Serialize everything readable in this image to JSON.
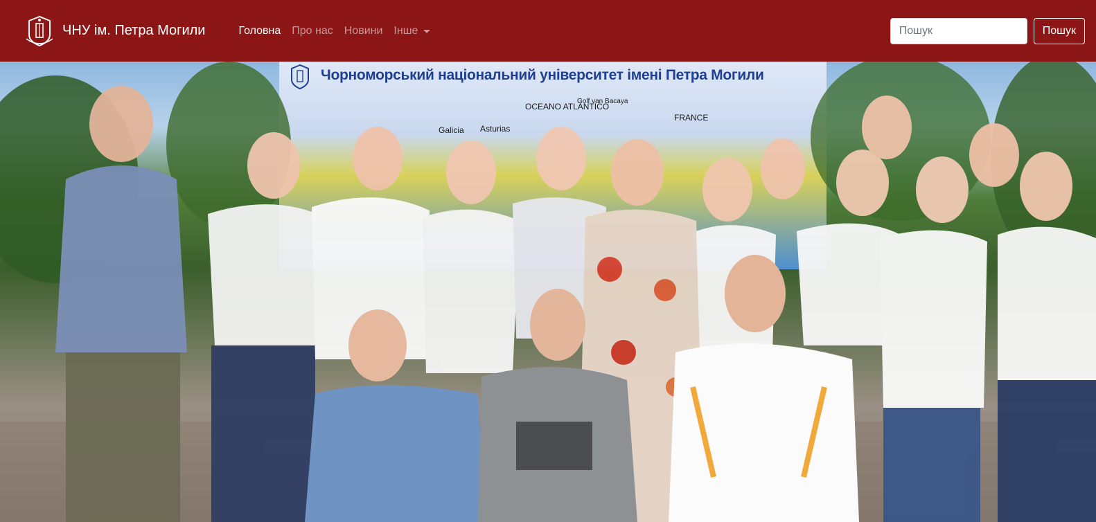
{
  "navbar": {
    "brand_text": "ЧНУ ім. Петра Могили",
    "logo_icon": "university-crest-icon",
    "links": [
      {
        "label": "Головна",
        "active": true
      },
      {
        "label": "Про нас",
        "active": false
      },
      {
        "label": "Новини",
        "active": false
      },
      {
        "label": "Інше",
        "active": false,
        "dropdown": true
      }
    ],
    "search": {
      "placeholder": "Пошук",
      "value": "",
      "button_label": "Пошук"
    }
  },
  "hero": {
    "banner_title": "Чорноморський національний університет імені Петра Могили",
    "map_labels": [
      "OCEANO ATLANTICO",
      "FRANCE",
      "Galicia",
      "Asturias",
      "Golf van Bacaya"
    ]
  },
  "colors": {
    "navbar_bg": "#8c1515",
    "brand_text": "#ffffff",
    "nav_inactive": "rgba(255,255,255,0.55)",
    "banner_title": "#1f3f8f"
  }
}
